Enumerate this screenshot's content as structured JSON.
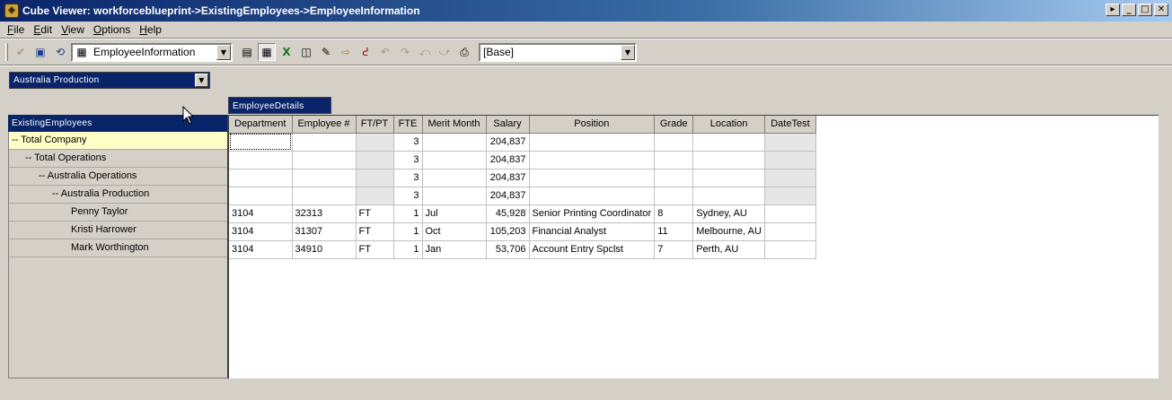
{
  "window": {
    "title": "Cube Viewer: workforceblueprint->ExistingEmployees->EmployeeInformation",
    "buttons": [
      "restore",
      "minimize",
      "maximize",
      "close"
    ]
  },
  "menu": {
    "items": [
      {
        "label": "File",
        "underline": "F",
        "rest": "ile"
      },
      {
        "label": "Edit",
        "underline": "E",
        "rest": "dit"
      },
      {
        "label": "View",
        "underline": "V",
        "rest": "iew"
      },
      {
        "label": "Options",
        "underline": "O",
        "rest": "ptions"
      },
      {
        "label": "Help",
        "underline": "H",
        "rest": "elp"
      }
    ]
  },
  "toolbar": {
    "view_selector": "EmployeeInformation",
    "base_selector": "[Base]",
    "icons": [
      "recalculate-check-icon",
      "save-icon",
      "refresh-icon",
      "cube-view-icon",
      "grid-view-icon",
      "chart-view-icon",
      "excel-icon",
      "view-properties-icon",
      "edit-icon",
      "export-icon",
      "spread-icon",
      "undo-icon",
      "redo-icon",
      "undo-all-icon",
      "print-icon"
    ]
  },
  "subset": {
    "title_dim_value": "Australia Production"
  },
  "column_dimension": {
    "name": "EmployeeDetails"
  },
  "row_dimension": {
    "name": "ExistingEmployees",
    "items": [
      {
        "label": "-- Total Company",
        "indent": 0,
        "selected": true
      },
      {
        "label": "-- Total Operations",
        "indent": 1,
        "selected": false
      },
      {
        "label": "-- Australia Operations",
        "indent": 2,
        "selected": false
      },
      {
        "label": "-- Australia Production",
        "indent": 3,
        "selected": false
      },
      {
        "label": "Penny Taylor",
        "indent": 4,
        "selected": false
      },
      {
        "label": "Kristi Harrower",
        "indent": 4,
        "selected": false
      },
      {
        "label": "Mark Worthington",
        "indent": 4,
        "selected": false
      }
    ]
  },
  "grid": {
    "columns": [
      "Department",
      "Employee #",
      "FT/PT",
      "FTE",
      "Merit Month",
      "Salary",
      "Position",
      "Grade",
      "Location",
      "DateTest"
    ],
    "rows": [
      [
        "",
        "",
        "",
        "3",
        "",
        "204,837",
        "",
        "",
        "",
        ""
      ],
      [
        "",
        "",
        "",
        "3",
        "",
        "204,837",
        "",
        "",
        "",
        ""
      ],
      [
        "",
        "",
        "",
        "3",
        "",
        "204,837",
        "",
        "",
        "",
        ""
      ],
      [
        "",
        "",
        "",
        "3",
        "",
        "204,837",
        "",
        "",
        "",
        ""
      ],
      [
        "3104",
        "32313",
        "FT",
        "1",
        "Jul",
        "45,928",
        "Senior Printing Coordinator",
        "8",
        "Sydney, AU",
        ""
      ],
      [
        "3104",
        "31307",
        "FT",
        "1",
        "Oct",
        "105,203",
        "Financial Analyst",
        "11",
        "Melbourne, AU",
        ""
      ],
      [
        "3104",
        "34910",
        "FT",
        "1",
        "Jan",
        "53,706",
        "Account Entry Spclst",
        "7",
        "Perth, AU",
        ""
      ]
    ]
  }
}
